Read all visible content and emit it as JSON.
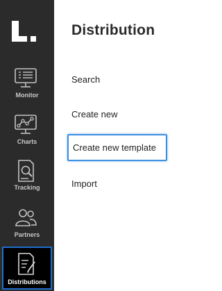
{
  "sidebar": {
    "items": [
      {
        "label": "Monitor",
        "icon": "monitor-icon"
      },
      {
        "label": "Charts",
        "icon": "chart-icon"
      },
      {
        "label": "Tracking",
        "icon": "tracking-icon"
      },
      {
        "label": "Partners",
        "icon": "partners-icon"
      },
      {
        "label": "Distributions",
        "icon": "distributions-icon",
        "active": true
      }
    ]
  },
  "main": {
    "title": "Distribution",
    "links": [
      "Search",
      "Create new",
      "Create new template",
      "Import"
    ]
  },
  "colors": {
    "sidebar_bg": "#2b2b2b",
    "focus": "#3d8fe0",
    "active_outline": "#1e6fcf"
  }
}
